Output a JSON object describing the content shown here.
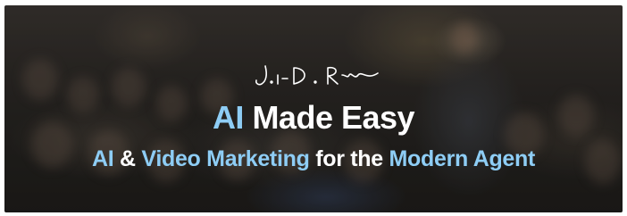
{
  "banner": {
    "signature_text": "J. D. Ryan",
    "headline": {
      "accent": "AI",
      "rest": " Made Easy"
    },
    "subline": {
      "part1": "AI",
      "part2": " & ",
      "part3": "Video Marketing",
      "part4": " for the ",
      "part5": "Modern Agent"
    }
  },
  "colors": {
    "accent": "#8ecdf5",
    "text": "#ffffff",
    "background": "#2b2825"
  }
}
